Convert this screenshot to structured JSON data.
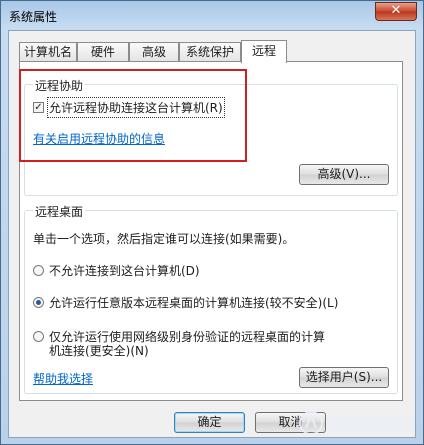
{
  "window": {
    "title": "系统属性",
    "close_glyph": "✕"
  },
  "tabs": [
    {
      "label": "计算机名"
    },
    {
      "label": "硬件"
    },
    {
      "label": "高级"
    },
    {
      "label": "系统保护"
    },
    {
      "label": "远程",
      "active": true
    }
  ],
  "remote_assistance": {
    "group_title": "远程协助",
    "allow_checkbox_label": "允许远程协助连接这台计算机(R)",
    "allow_checked": true,
    "info_link": "有关启用远程协助的信息",
    "advanced_button": "高级(V)..."
  },
  "remote_desktop": {
    "group_title": "远程桌面",
    "instruction": "单击一个选项，然后指定谁可以连接(如果需要)。",
    "options": [
      {
        "label": "不允许连接到这台计算机(D)",
        "selected": false
      },
      {
        "label": "允许运行任意版本远程桌面的计算机连接(较不安全)(L)",
        "selected": true
      },
      {
        "label_line1": "仅允许运行使用网络级别身份验证的远程桌面的计算",
        "label_line2": "机连接(更安全)(N)",
        "selected": false
      }
    ],
    "help_link": "帮助我选择",
    "select_users_button": "选择用户(S)..."
  },
  "footer": {
    "ok_button": "确定",
    "cancel_button": "取消"
  },
  "colors": {
    "highlight_box": "#d21e1e",
    "link": "#0066cc"
  }
}
